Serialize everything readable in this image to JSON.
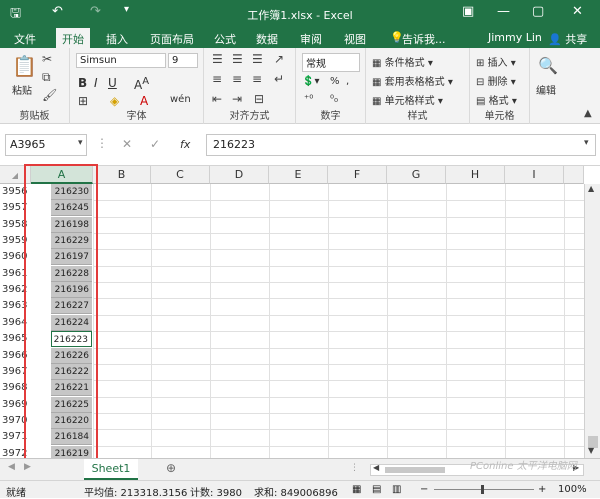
{
  "window": {
    "title": "工作簿1.xlsx - Excel"
  },
  "tabs": [
    "文件",
    "开始",
    "插入",
    "页面布局",
    "公式",
    "数据",
    "审阅",
    "视图"
  ],
  "tellme": "告诉我...",
  "user": "Jimmy Lin",
  "share": "共享",
  "ribbon": {
    "clipboard": {
      "label": "剪贴板",
      "paste": "粘贴"
    },
    "font": {
      "label": "字体",
      "name": "Simsun",
      "size": "9"
    },
    "align": {
      "label": "对齐方式"
    },
    "number": {
      "label": "数字",
      "format": "常规"
    },
    "styles": {
      "label": "样式",
      "cond": "条件格式",
      "table": "套用表格格式",
      "cell": "单元格样式"
    },
    "cells": {
      "label": "单元格",
      "insert": "插入",
      "delete": "删除",
      "format": "格式"
    },
    "editing": {
      "label": "编辑"
    }
  },
  "formula_bar": {
    "name_box": "A3965",
    "fx": "fx",
    "formula": "216223"
  },
  "columns": [
    "A",
    "B",
    "C",
    "D",
    "E",
    "F",
    "G",
    "H",
    "I"
  ],
  "rows": [
    {
      "n": "3956",
      "v": "216230"
    },
    {
      "n": "3957",
      "v": "216245"
    },
    {
      "n": "3958",
      "v": "216198"
    },
    {
      "n": "3959",
      "v": "216229"
    },
    {
      "n": "3960",
      "v": "216197"
    },
    {
      "n": "3961",
      "v": "216228"
    },
    {
      "n": "3962",
      "v": "216196"
    },
    {
      "n": "3963",
      "v": "216227"
    },
    {
      "n": "3964",
      "v": "216224"
    },
    {
      "n": "3965",
      "v": "216223"
    },
    {
      "n": "3966",
      "v": "216226"
    },
    {
      "n": "3967",
      "v": "216222"
    },
    {
      "n": "3968",
      "v": "216221"
    },
    {
      "n": "3969",
      "v": "216225"
    },
    {
      "n": "3970",
      "v": "216220"
    },
    {
      "n": "3971",
      "v": "216184"
    },
    {
      "n": "3972",
      "v": "216219"
    }
  ],
  "sheet_tab": "Sheet1",
  "status": {
    "ready": "就绪",
    "avg": "平均值: 213318.3156",
    "count": "计数: 3980",
    "sum": "求和: 849006896",
    "zoom": "100%"
  },
  "watermark": "PConline 太平洋电脑网",
  "accent": "#217346"
}
